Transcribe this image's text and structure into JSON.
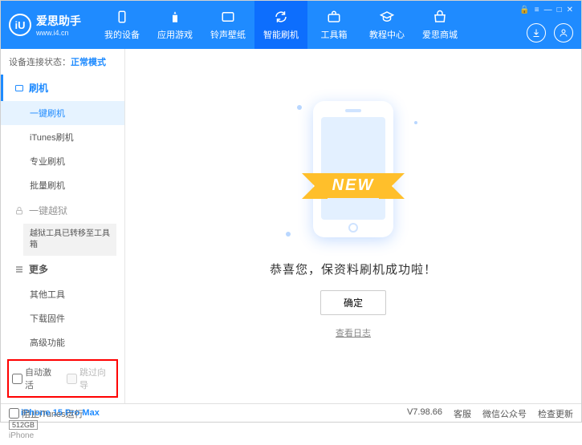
{
  "logo": {
    "badge": "iU",
    "name": "爱思助手",
    "url": "www.i4.cn"
  },
  "nav": [
    {
      "label": "我的设备"
    },
    {
      "label": "应用游戏"
    },
    {
      "label": "铃声壁纸"
    },
    {
      "label": "智能刷机"
    },
    {
      "label": "工具箱"
    },
    {
      "label": "教程中心"
    },
    {
      "label": "爱思商城"
    }
  ],
  "status": {
    "prefix": "设备连接状态：",
    "mode": "正常模式"
  },
  "tree": {
    "head1": "刷机",
    "items1": [
      "一键刷机",
      "iTunes刷机",
      "专业刷机",
      "批量刷机"
    ],
    "head2": "一键越狱",
    "box": "越狱工具已转移至工具箱",
    "head3": "更多",
    "items3": [
      "其他工具",
      "下载固件",
      "高级功能"
    ]
  },
  "checks": {
    "auto": "自动激活",
    "skip": "跳过向导"
  },
  "device": {
    "name": "iPhone 15 Pro Max",
    "storage": "512GB",
    "type": "iPhone"
  },
  "main": {
    "ribbon": "NEW",
    "success": "恭喜您，保资料刷机成功啦！",
    "ok": "确定",
    "log": "查看日志"
  },
  "footer": {
    "block": "阻止iTunes运行",
    "version": "V7.98.66",
    "links": [
      "客服",
      "微信公众号",
      "检查更新"
    ]
  }
}
